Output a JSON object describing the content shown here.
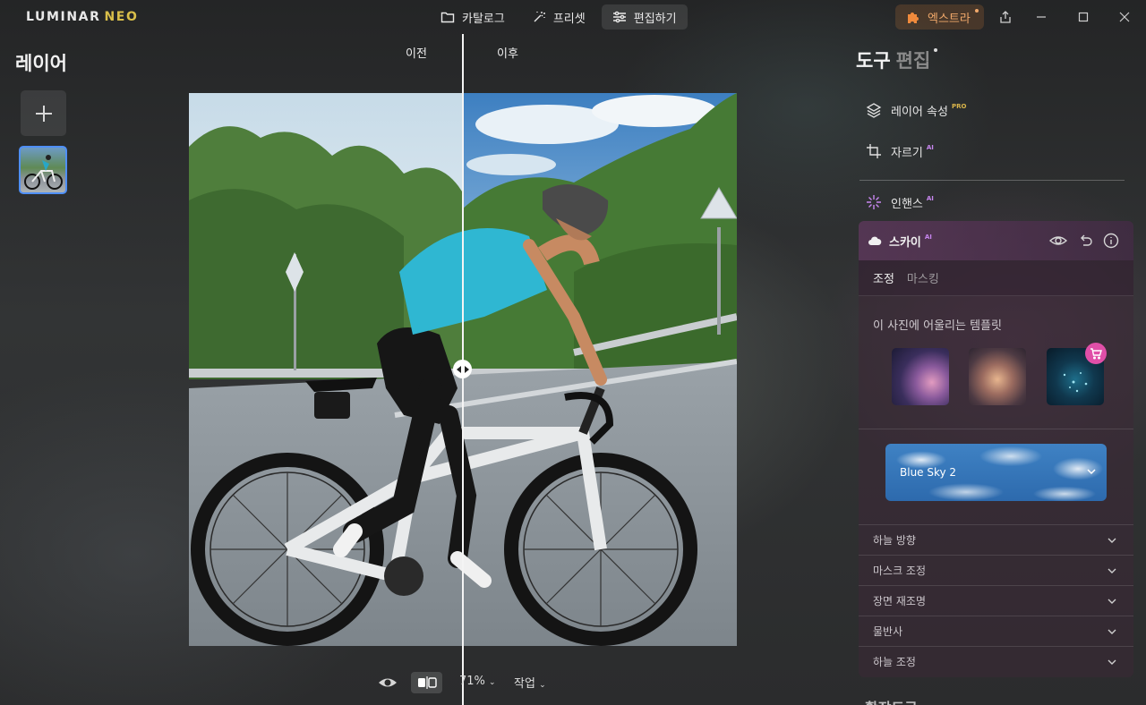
{
  "app": {
    "logo_main": "LUMINAR",
    "logo_neo": "NEO"
  },
  "nav": {
    "catalog": "카탈로그",
    "presets": "프리셋",
    "edit": "편집하기"
  },
  "extras": {
    "label": "엑스트라"
  },
  "layers": {
    "title": "레이어"
  },
  "compare": {
    "before": "이전",
    "after": "이후"
  },
  "bottom": {
    "zoom": "71%",
    "work": "작업"
  },
  "right": {
    "tab_tools": "도구",
    "tab_edit": "편집",
    "tools": [
      {
        "label": "레이어 속성",
        "badge": "PRO"
      },
      {
        "label": "자르기",
        "badge": "AI"
      },
      {
        "label": "인핸스",
        "badge": "AI"
      }
    ],
    "sky": {
      "title": "스카이",
      "badge": "AI",
      "subtabs": [
        "조정",
        "마스킹"
      ],
      "templates_title": "이 사진에 어울리는 템플릿",
      "selected_sky": "Blue Sky 2",
      "sections": [
        "하늘 방향",
        "마스크 조정",
        "장면 재조명",
        "물반사",
        "하늘 조정"
      ]
    },
    "addon_tools": "확장도구"
  },
  "colors": {
    "accent_blue": "#4f8ff7",
    "extras_orange": "#f2a96b",
    "pro_gold": "#d9b44a",
    "ai_purple": "#c887f0",
    "cart_pink": "#e04fa8"
  }
}
